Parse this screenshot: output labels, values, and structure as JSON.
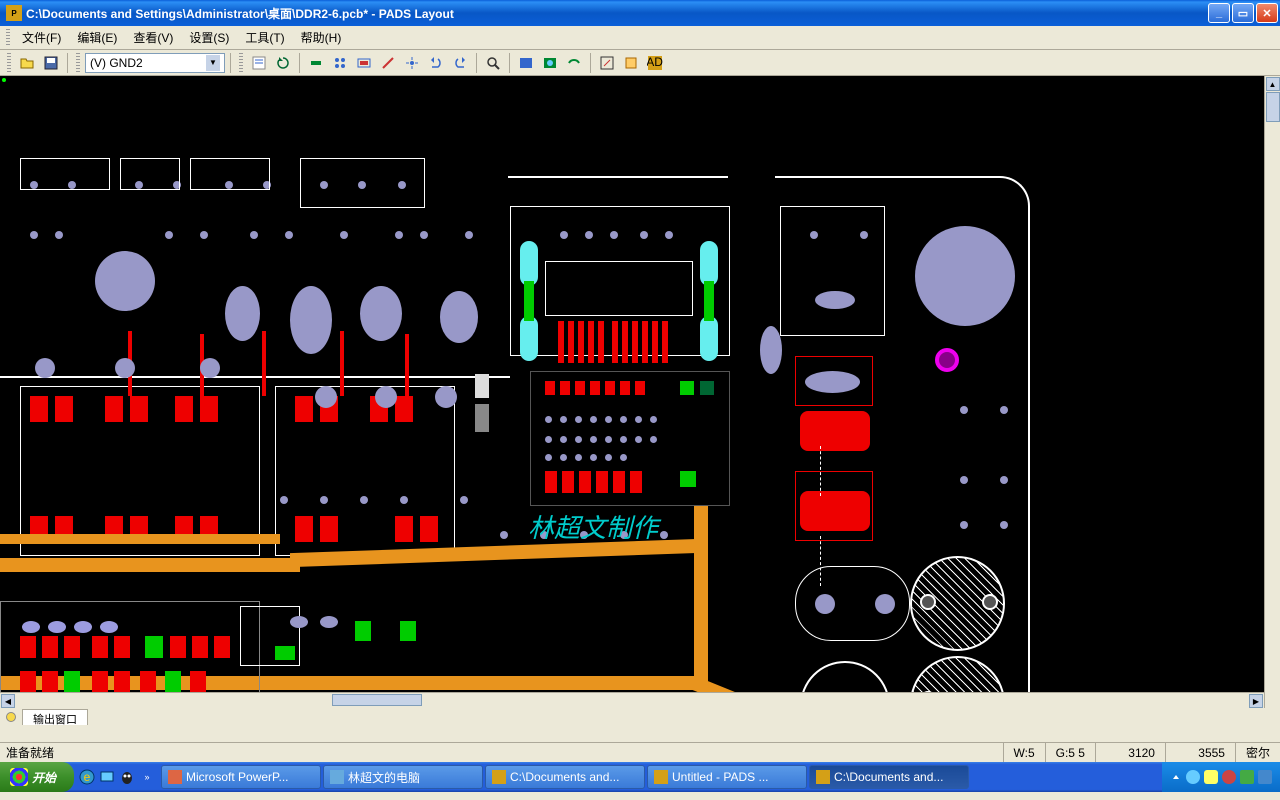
{
  "title": "C:\\Documents and Settings\\Administrator\\桌面\\DDR2-6.pcb* - PADS Layout",
  "menu": {
    "file": "文件(F)",
    "edit": "编辑(E)",
    "view": "查看(V)",
    "setup": "设置(S)",
    "tools": "工具(T)",
    "help": "帮助(H)"
  },
  "toolbar": {
    "layer_selected": "(V) GND2"
  },
  "canvas": {
    "watermark": "林超文制作"
  },
  "output_window": {
    "tab": "输出窗口"
  },
  "status": {
    "msg": "准备就绪",
    "w": "W:5",
    "g": "G:5 5",
    "x": "3120",
    "y": "3555",
    "unit": "密尔"
  },
  "taskbar": {
    "start": "开始",
    "buttons": [
      {
        "label": "Microsoft PowerP..."
      },
      {
        "label": "林超文的电脑"
      },
      {
        "label": "C:\\Documents and..."
      },
      {
        "label": "Untitled - PADS ..."
      },
      {
        "label": "C:\\Documents and..."
      }
    ]
  }
}
